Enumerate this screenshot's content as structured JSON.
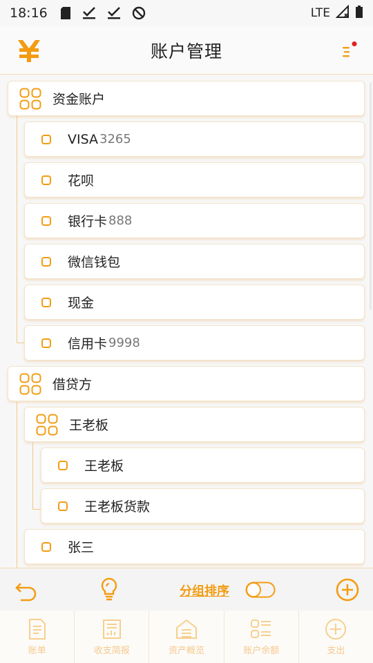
{
  "status_bar": {
    "time": "18:16",
    "network": "LTE",
    "icons": [
      "sd-card-icon",
      "check-icon",
      "check-icon",
      "no-sync-icon",
      "signal-icon",
      "battery-icon"
    ]
  },
  "header": {
    "title": "账户管理",
    "logo_icon": "yen-logo-icon",
    "menu_icon": "menu-notification-icon"
  },
  "groups": [
    {
      "label": "资金账户",
      "items": [
        {
          "label": "VISA",
          "num": "3265"
        },
        {
          "label": "花呗",
          "num": ""
        },
        {
          "label": "银行卡",
          "num": "888"
        },
        {
          "label": "微信钱包",
          "num": ""
        },
        {
          "label": "现金",
          "num": ""
        },
        {
          "label": "信用卡",
          "num": "9998"
        }
      ]
    },
    {
      "label": "借贷方",
      "subgroup": {
        "label": "王老板",
        "items": [
          {
            "label": "王老板",
            "num": ""
          },
          {
            "label": "王老板货款",
            "num": ""
          }
        ]
      },
      "items": [
        {
          "label": "张三",
          "num": ""
        }
      ]
    }
  ],
  "toolbar": {
    "back_icon": "undo-icon",
    "tip_icon": "lightbulb-icon",
    "sort_label": "分组排序",
    "toggle_icon": "toggle-icon",
    "add_icon": "add-circle-icon"
  },
  "bottom_nav": [
    {
      "label": "账单",
      "icon": "bill-icon"
    },
    {
      "label": "收支简报",
      "icon": "report-icon"
    },
    {
      "label": "资产概览",
      "icon": "assets-icon"
    },
    {
      "label": "账户余额",
      "icon": "balance-icon"
    },
    {
      "label": "支出",
      "icon": "expense-icon"
    }
  ],
  "colors": {
    "accent": "#f39c12",
    "line": "#f0c98a",
    "badge": "#e02020"
  }
}
